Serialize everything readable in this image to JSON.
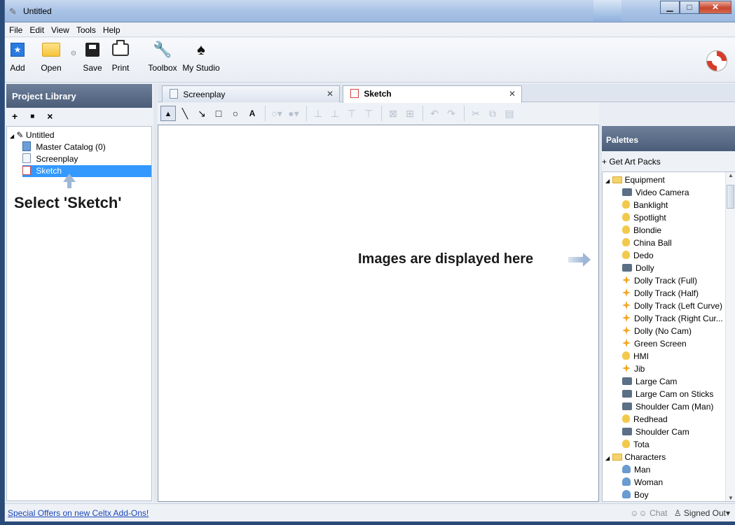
{
  "window": {
    "title": "Untitled",
    "controls": {
      "minimize": "▁",
      "maximize": "□",
      "close": "✕"
    }
  },
  "menu": [
    "File",
    "Edit",
    "View",
    "Tools",
    "Help"
  ],
  "toolbar": [
    {
      "label": "Add",
      "icon": "add-icon"
    },
    {
      "label": "Open",
      "icon": "folder-icon"
    },
    {
      "label": "Save",
      "icon": "save-icon"
    },
    {
      "label": "Print",
      "icon": "printer-icon"
    },
    {
      "label": "Toolbox",
      "icon": "wrench-icon"
    },
    {
      "label": "My Studio",
      "icon": "studio-icon"
    }
  ],
  "library": {
    "title": "Project Library",
    "tools": [
      "+",
      "■",
      "×"
    ],
    "root": "Untitled",
    "items": [
      "Master Catalog (0)",
      "Screenplay",
      "Sketch"
    ],
    "annotation": "Select 'Sketch'"
  },
  "tabs": [
    {
      "label": "Screenplay",
      "active": false
    },
    {
      "label": "Sketch",
      "active": true
    }
  ],
  "draw_tools": [
    "▲",
    "╲",
    "↘",
    "□",
    "○",
    "A"
  ],
  "canvas_annotation": "Images are displayed here",
  "palettes": {
    "title": "Palettes",
    "get_art_packs": "+ Get Art Packs",
    "groups": [
      {
        "name": "Equipment",
        "items": [
          {
            "label": "Video Camera",
            "icon": "camera-icon"
          },
          {
            "label": "Banklight",
            "icon": "bulb-icon"
          },
          {
            "label": "Spotlight",
            "icon": "bulb-icon"
          },
          {
            "label": "Blondie",
            "icon": "bulb-icon"
          },
          {
            "label": "China Ball",
            "icon": "bulb-icon"
          },
          {
            "label": "Dedo",
            "icon": "bulb-icon"
          },
          {
            "label": "Dolly",
            "icon": "camera-icon"
          },
          {
            "label": "Dolly Track (Full)",
            "icon": "track-icon"
          },
          {
            "label": "Dolly Track (Half)",
            "icon": "track-icon"
          },
          {
            "label": "Dolly Track (Left Curve)",
            "icon": "track-icon"
          },
          {
            "label": "Dolly Track (Right Cur...",
            "icon": "track-icon"
          },
          {
            "label": "Dolly (No Cam)",
            "icon": "track-icon"
          },
          {
            "label": "Green Screen",
            "icon": "track-icon"
          },
          {
            "label": "HMI",
            "icon": "bulb-icon"
          },
          {
            "label": "Jib",
            "icon": "track-icon"
          },
          {
            "label": "Large Cam",
            "icon": "camera-icon"
          },
          {
            "label": "Large Cam on Sticks",
            "icon": "camera-icon"
          },
          {
            "label": "Shoulder Cam (Man)",
            "icon": "camera-icon"
          },
          {
            "label": "Redhead",
            "icon": "bulb-icon"
          },
          {
            "label": "Shoulder Cam",
            "icon": "camera-icon"
          },
          {
            "label": "Tota",
            "icon": "bulb-icon"
          }
        ]
      },
      {
        "name": "Characters",
        "items": [
          {
            "label": "Man",
            "icon": "person-icon"
          },
          {
            "label": "Woman",
            "icon": "person-icon"
          },
          {
            "label": "Boy",
            "icon": "person-icon"
          }
        ]
      }
    ]
  },
  "status": {
    "offers": "Special Offers on new Celtx Add-Ons!",
    "chat": "Chat",
    "signed": "Signed Out"
  },
  "colors": {
    "selection": "#3399ff",
    "panel_header": "#5a6c87",
    "link": "#1c48b8"
  }
}
